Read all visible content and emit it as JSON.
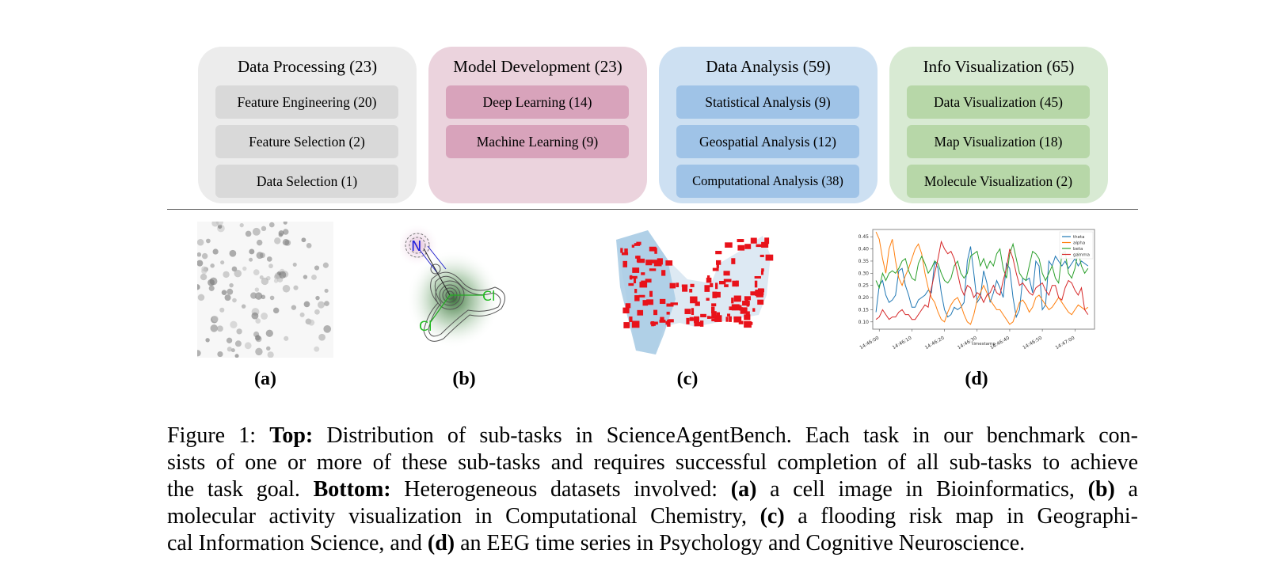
{
  "categories": [
    {
      "title": "Data Processing (23)",
      "bg": "#ececec",
      "sub_bg": "#d9d9d9",
      "subtasks": [
        "Feature Engineering (20)",
        "Feature Selection (2)",
        "Data Selection (1)"
      ]
    },
    {
      "title": "Model Development (23)",
      "bg": "#ebd3dd",
      "sub_bg": "#d8a3bb",
      "subtasks": [
        "Deep Learning (14)",
        "Machine Learning (9)"
      ]
    },
    {
      "title": "Data Analysis (59)",
      "bg": "#cde0f2",
      "sub_bg": "#9fc3e7",
      "subtasks": [
        "Statistical Analysis (9)",
        "Geospatial Analysis (12)",
        "Computational Analysis (38)"
      ]
    },
    {
      "title": "Info Visualization (65)",
      "bg": "#d8ead3",
      "sub_bg": "#b7d7a8",
      "subtasks": [
        "Data Visualization (45)",
        "Map Visualization (18)",
        "Molecule Visualization (2)"
      ]
    }
  ],
  "panels": {
    "a": {
      "label": "(a)"
    },
    "b": {
      "label": "(b)",
      "atoms": [
        "N",
        "Cl",
        "Cl"
      ]
    },
    "c": {
      "label": "(c)"
    },
    "d": {
      "label": "(d)"
    }
  },
  "chart_data": {
    "type": "line",
    "title": "",
    "xlabel": "timestamp",
    "ylabel": "",
    "x_ticks": [
      "14:46:00",
      "14:46:10",
      "14:46:20",
      "14:46:30",
      "14:46:40",
      "14:46:50",
      "14:47:00"
    ],
    "y_ticks": [
      "0.10",
      "0.15",
      "0.20",
      "0.25",
      "0.30",
      "0.35",
      "0.40",
      "0.45"
    ],
    "ylim": [
      0.07,
      0.48
    ],
    "xlim_seconds": [
      -2,
      66
    ],
    "legend_position": "top-right",
    "x_seconds": [
      -1,
      0,
      1,
      2,
      3,
      4,
      5,
      6,
      7,
      8,
      9,
      10,
      11,
      12,
      13,
      14,
      15,
      16,
      17,
      18,
      19,
      20,
      21,
      22,
      23,
      24,
      25,
      26,
      27,
      28,
      29,
      30,
      31,
      32,
      33,
      34,
      35,
      36,
      37,
      38,
      39,
      40,
      41,
      42,
      43,
      44,
      45,
      46,
      47,
      48,
      49,
      50,
      51,
      52,
      53,
      54,
      55,
      56,
      57,
      58,
      59,
      60,
      61,
      62,
      63,
      64
    ],
    "series": [
      {
        "name": "theta",
        "color": "#1f77b4",
        "values": [
          0.14,
          0.25,
          0.27,
          0.21,
          0.18,
          0.19,
          0.21,
          0.31,
          0.32,
          0.25,
          0.21,
          0.16,
          0.16,
          0.19,
          0.2,
          0.21,
          0.23,
          0.22,
          0.35,
          0.32,
          0.22,
          0.15,
          0.12,
          0.13,
          0.16,
          0.15,
          0.16,
          0.18,
          0.35,
          0.41,
          0.3,
          0.18,
          0.2,
          0.31,
          0.26,
          0.18,
          0.22,
          0.27,
          0.24,
          0.2,
          0.34,
          0.32,
          0.2,
          0.12,
          0.15,
          0.28,
          0.27,
          0.28,
          0.22,
          0.35,
          0.33,
          0.15,
          0.17,
          0.35,
          0.33,
          0.37,
          0.35,
          0.33,
          0.35,
          0.32,
          0.34,
          0.36,
          0.33,
          0.35,
          0.34,
          0.33
        ]
      },
      {
        "name": "alpha",
        "color": "#ff7f0e",
        "values": [
          0.47,
          0.44,
          0.36,
          0.3,
          0.4,
          0.44,
          0.35,
          0.28,
          0.25,
          0.29,
          0.32,
          0.36,
          0.4,
          0.42,
          0.38,
          0.3,
          0.24,
          0.2,
          0.18,
          0.14,
          0.11,
          0.1,
          0.14,
          0.17,
          0.19,
          0.2,
          0.17,
          0.13,
          0.1,
          0.09,
          0.13,
          0.19,
          0.22,
          0.25,
          0.22,
          0.19,
          0.17,
          0.15,
          0.15,
          0.13,
          0.11,
          0.09,
          0.1,
          0.14,
          0.18,
          0.19,
          0.17,
          0.14,
          0.16,
          0.2,
          0.21,
          0.19,
          0.17,
          0.15,
          0.16,
          0.18,
          0.2,
          0.18,
          0.16,
          0.14,
          0.13,
          0.15,
          0.17,
          0.16,
          0.15,
          0.16
        ]
      },
      {
        "name": "beta",
        "color": "#2ca02c",
        "values": [
          0.27,
          0.24,
          0.3,
          0.27,
          0.3,
          0.31,
          0.3,
          0.32,
          0.35,
          0.36,
          0.31,
          0.28,
          0.27,
          0.34,
          0.37,
          0.34,
          0.3,
          0.32,
          0.35,
          0.34,
          0.3,
          0.27,
          0.26,
          0.28,
          0.33,
          0.35,
          0.3,
          0.28,
          0.3,
          0.37,
          0.38,
          0.39,
          0.33,
          0.36,
          0.32,
          0.35,
          0.33,
          0.38,
          0.4,
          0.32,
          0.28,
          0.38,
          0.42,
          0.36,
          0.3,
          0.28,
          0.27,
          0.33,
          0.39,
          0.38,
          0.36,
          0.3,
          0.27,
          0.3,
          0.33,
          0.28,
          0.26,
          0.38,
          0.39,
          0.3,
          0.28,
          0.32,
          0.39,
          0.33,
          0.3,
          0.32
        ]
      },
      {
        "name": "gamma",
        "color": "#d62728",
        "values": [
          0.11,
          0.12,
          0.15,
          0.13,
          0.11,
          0.12,
          0.12,
          0.14,
          0.15,
          0.13,
          0.13,
          0.11,
          0.11,
          0.13,
          0.15,
          0.17,
          0.16,
          0.24,
          0.3,
          0.36,
          0.43,
          0.4,
          0.38,
          0.39,
          0.36,
          0.3,
          0.24,
          0.21,
          0.25,
          0.24,
          0.2,
          0.22,
          0.21,
          0.18,
          0.21,
          0.22,
          0.25,
          0.22,
          0.21,
          0.27,
          0.32,
          0.4,
          0.36,
          0.3,
          0.25,
          0.26,
          0.24,
          0.22,
          0.21,
          0.24,
          0.25,
          0.26,
          0.23,
          0.21,
          0.25,
          0.25,
          0.2,
          0.19,
          0.24,
          0.27,
          0.26,
          0.23,
          0.21,
          0.24,
          0.15,
          0.13
        ]
      }
    ]
  },
  "caption": {
    "lines": [
      [
        {
          "t": "Figure 1: "
        },
        {
          "t": "Top:",
          "b": true
        },
        {
          "t": " Distribution of sub-tasks in ScienceAgentBench. Each task in our benchmark con-"
        }
      ],
      [
        {
          "t": "sists of one or more of these sub-tasks and requires successful completion of all sub-tasks to achieve"
        }
      ],
      [
        {
          "t": "the task goal. "
        },
        {
          "t": "Bottom:",
          "b": true
        },
        {
          "t": " Heterogeneous datasets involved: "
        },
        {
          "t": "(a)",
          "b": true
        },
        {
          "t": " a cell image in Bioinformatics, "
        },
        {
          "t": "(b)",
          "b": true
        },
        {
          "t": " a"
        }
      ],
      [
        {
          "t": "molecular activity visualization in Computational Chemistry, "
        },
        {
          "t": "(c)",
          "b": true
        },
        {
          "t": " a flooding risk map in Geographi-"
        }
      ],
      [
        {
          "t": "cal Information Science, and "
        },
        {
          "t": "(d)",
          "b": true
        },
        {
          "t": " an EEG time series in Psychology and Cognitive Neuroscience."
        }
      ]
    ]
  }
}
